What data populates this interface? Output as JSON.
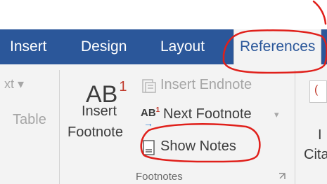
{
  "tabs": {
    "insert": "Insert",
    "design": "Design",
    "layout": "Layout",
    "references": "References"
  },
  "left_partial": {
    "top_label": "xt ▾",
    "table": "Table"
  },
  "footnotes_group": {
    "insert_footnote_line1": "Insert",
    "insert_footnote_line2": "Footnote",
    "ab_icon_text": "AB",
    "ab_superscript": "1",
    "insert_endnote": "Insert Endnote",
    "next_footnote": "Next Footnote",
    "next_footnote_caret": "▾",
    "show_notes": "Show Notes",
    "group_label": "Footnotes"
  },
  "right_partial": {
    "line1": "I",
    "line2": "Cita"
  },
  "colors": {
    "ribbon_blue": "#2b579a",
    "annotation_red": "#e0201b",
    "ribbon_bg": "#f3f3f3"
  }
}
